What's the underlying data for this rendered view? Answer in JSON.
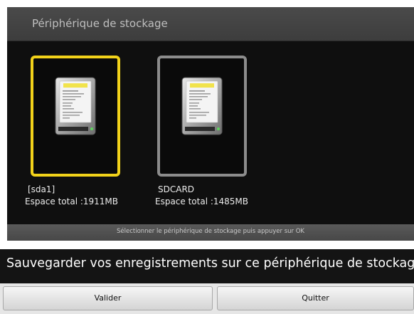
{
  "panel": {
    "title": "Périphérique de stockage",
    "footer_hint": "Sélectionner le périphérique de stockage puis appuyer sur OK"
  },
  "devices": [
    {
      "name": "[sda1]",
      "space": "Espace total :1911MB",
      "selected": true,
      "icon": "hard-drive-icon"
    },
    {
      "name": "SDCARD",
      "space": "Espace total :1485MB",
      "selected": false,
      "icon": "hard-drive-icon"
    }
  ],
  "dialog": {
    "question": "Sauvegarder vos enregistrements sur ce périphérique de stockage?",
    "validate_label": "Valider",
    "quit_label": "Quitter"
  },
  "colors": {
    "selected_border": "#f2d21a",
    "unselected_border": "#8c8c8c",
    "panel_background": "#0f0f0f",
    "header_background": "#444444"
  }
}
